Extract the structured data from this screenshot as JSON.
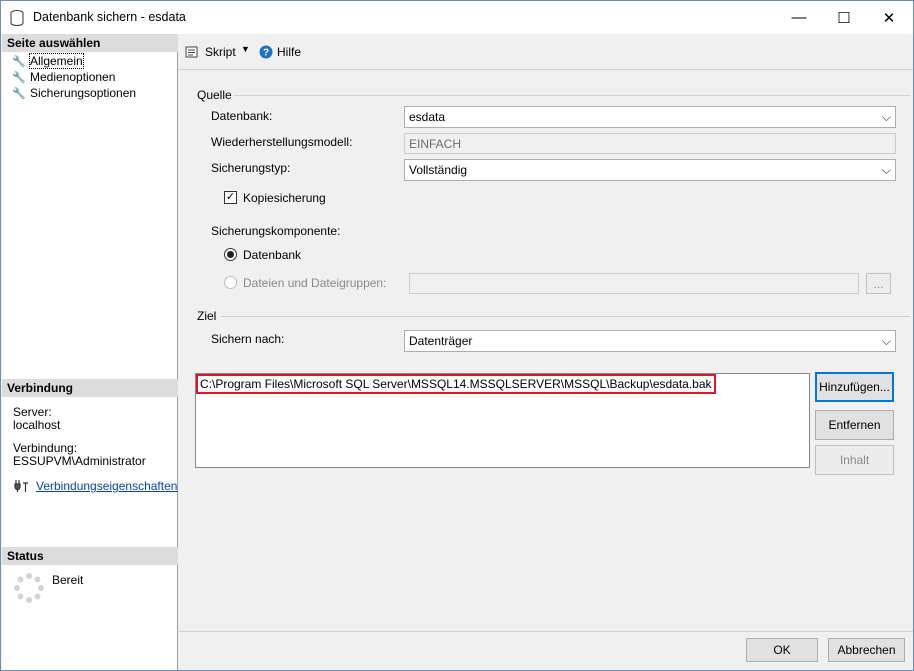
{
  "window": {
    "title": "Datenbank sichern - esdata",
    "minimize": "—",
    "maximize": "☐",
    "close": "✕"
  },
  "sidebar": {
    "header": "Seite auswählen",
    "items": [
      {
        "label": "Allgemein"
      },
      {
        "label": "Medienoptionen"
      },
      {
        "label": "Sicherungsoptionen"
      }
    ],
    "connection": {
      "header": "Verbindung",
      "server_label": "Server:",
      "server_value": "localhost",
      "connection_label": "Verbindung:",
      "connection_value": "ESSUPVM\\Administrator",
      "properties_link": "Verbindungseigenschaften anzeigen"
    },
    "status": {
      "header": "Status",
      "value": "Bereit"
    }
  },
  "toolbar": {
    "script_label": "Skript",
    "help_label": "Hilfe"
  },
  "source": {
    "group_label": "Quelle",
    "database_label": "Datenbank:",
    "database_value": "esdata",
    "recovery_label": "Wiederherstellungsmodell:",
    "recovery_value": "EINFACH",
    "backup_type_label": "Sicherungstyp:",
    "backup_type_value": "Vollständig",
    "copy_only_label": "Kopiesicherung",
    "copy_only_checked": true,
    "component_label": "Sicherungskomponente:",
    "component_database_label": "Datenbank",
    "component_files_label": "Dateien und Dateigruppen:",
    "browse_label": "..."
  },
  "destination": {
    "group_label": "Ziel",
    "backup_to_label": "Sichern nach:",
    "backup_to_value": "Datenträger",
    "files": [
      "C:\\Program Files\\Microsoft SQL Server\\MSSQL14.MSSQLSERVER\\MSSQL\\Backup\\esdata.bak"
    ],
    "add_label": "Hinzufügen...",
    "remove_label": "Entfernen",
    "contents_label": "Inhalt"
  },
  "footer": {
    "ok_label": "OK",
    "cancel_label": "Abbrechen"
  },
  "colors": {
    "highlight_border": "#e81123",
    "default_button_border": "#0078d7",
    "link": "#0645ad"
  }
}
